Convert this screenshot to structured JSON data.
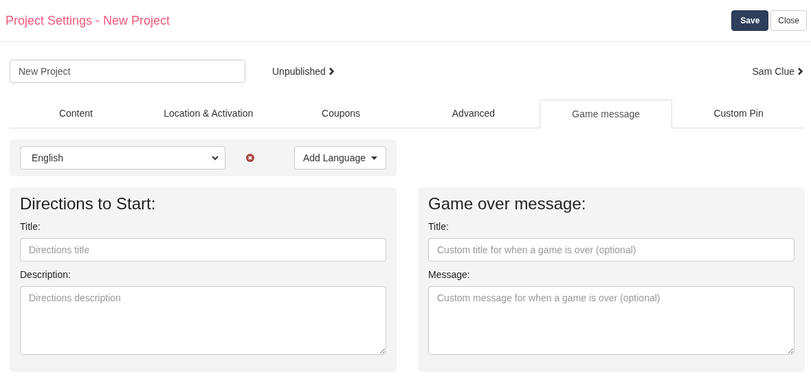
{
  "header": {
    "title": "Project Settings - New Project",
    "buttons": [
      {
        "label": "Save",
        "kind": "primary"
      },
      {
        "label": "Close",
        "kind": "default"
      }
    ]
  },
  "project": {
    "name": "New Project",
    "status": "Unpublished",
    "owner": "Sam Clue"
  },
  "tabs": [
    {
      "label": "Content",
      "selected": false
    },
    {
      "label": "Location & Activation",
      "selected": false
    },
    {
      "label": "Coupons",
      "selected": false
    },
    {
      "label": "Advanced",
      "selected": false
    },
    {
      "label": "Game message",
      "selected": true
    },
    {
      "label": "Custom Pin",
      "selected": false
    }
  ],
  "language": {
    "value": "English",
    "add_button": "Add Language"
  },
  "panels": [
    {
      "heading": "Directions to Start:",
      "fields": [
        {
          "kind": "input",
          "label": "Title:",
          "placeholder": "Directions title"
        },
        {
          "kind": "textarea",
          "label": "Description:",
          "placeholder": "Directions description"
        }
      ]
    },
    {
      "heading": "Game over message:",
      "fields": [
        {
          "kind": "input",
          "label": "Title:",
          "placeholder": "Custom title for when a game is over (optional)"
        },
        {
          "kind": "textarea",
          "label": "Message:",
          "placeholder": "Custom message for when a game is over (optional)"
        }
      ]
    }
  ]
}
